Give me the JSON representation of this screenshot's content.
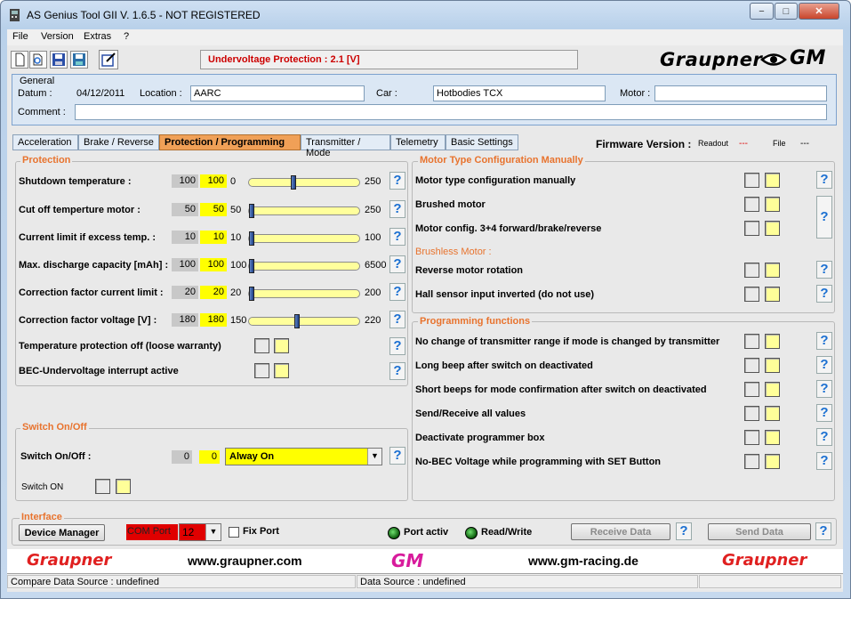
{
  "window": {
    "title": "AS Genius Tool GII V. 1.6.5 - NOT REGISTERED",
    "min": "−",
    "max": "□",
    "close": "✕"
  },
  "menu": [
    "File",
    "Version",
    "Extras",
    "?"
  ],
  "status_message": "Undervoltage Protection : 2.1 [V]",
  "logo_top": "Graupner",
  "logo_gm": "GM",
  "general": {
    "title": "General",
    "datum_label": "Datum :",
    "datum_value": "04/12/2011",
    "location_label": "Location :",
    "location_value": "AARC",
    "car_label": "Car :",
    "car_value": "Hotbodies TCX",
    "motor_label": "Motor :",
    "motor_value": "",
    "comment_label": "Comment :",
    "comment_value": ""
  },
  "tabs": [
    "Acceleration",
    "Brake / Reverse",
    "Protection / Programming",
    "Transmitter / Mode",
    "Telemetry",
    "Basic Settings"
  ],
  "firmware": {
    "label": "Firmware Version :",
    "readout_label": "Readout",
    "readout_value": "---",
    "file_label": "File",
    "file_value": "---"
  },
  "protection": {
    "title": "Protection",
    "rows": [
      {
        "label": "Shutdown temperature :",
        "gray": "100",
        "yellow": "100",
        "min": "0",
        "max": "250",
        "value": 100,
        "lo": 0,
        "hi": 250
      },
      {
        "label": "Cut off temperture motor :",
        "gray": "50",
        "yellow": "50",
        "min": "50",
        "max": "250",
        "value": 50,
        "lo": 50,
        "hi": 250
      },
      {
        "label": "Current limit if excess temp. :",
        "gray": "10",
        "yellow": "10",
        "min": "10",
        "max": "100",
        "value": 10,
        "lo": 10,
        "hi": 100
      },
      {
        "label": "Max. discharge capacity [mAh] :",
        "gray": "100",
        "yellow": "100",
        "min": "100",
        "max": "6500",
        "value": 100,
        "lo": 100,
        "hi": 6500
      },
      {
        "label": "Correction factor current limit :",
        "gray": "20",
        "yellow": "20",
        "min": "20",
        "max": "200",
        "value": 20,
        "lo": 20,
        "hi": 200
      },
      {
        "label": "Correction factor voltage [V] :",
        "gray": "180",
        "yellow": "180",
        "min": "150",
        "max": "220",
        "value": 180,
        "lo": 150,
        "hi": 220
      }
    ],
    "temp_off_label": "Temperature protection off (loose warranty)",
    "bec_label": "BEC-Undervoltage interrupt active"
  },
  "switch": {
    "title": "Switch On/Off",
    "label": "Switch On/Off :",
    "gray": "0",
    "yellow": "0",
    "select_value": "Alway On",
    "switch_on_label": "Switch ON"
  },
  "motor_type": {
    "title": "Motor Type Configuration Manually",
    "rows": [
      "Motor type configuration manually",
      "Brushed motor",
      "Motor config. 3+4 forward/brake/reverse"
    ],
    "brushless_title": "Brushless Motor :",
    "brushless_rows": [
      "Reverse motor rotation",
      "Hall sensor input inverted (do not use)"
    ]
  },
  "programming": {
    "title": "Programming functions",
    "rows": [
      "No change of transmitter range if mode is changed by transmitter",
      "Long beep after switch on deactivated",
      "Short beeps for mode confirmation after switch on deactivated",
      "Send/Receive all values",
      "Deactivate programmer box",
      "No-BEC Voltage while programming with SET Button"
    ]
  },
  "interface": {
    "title": "Interface",
    "device_manager": "Device Manager",
    "com_port_label": "COM Port",
    "com_port_value": "12",
    "fix_port": "Fix Port",
    "port_activ": "Port activ",
    "read_write": "Read/Write",
    "receive": "Receive Data",
    "send": "Send Data"
  },
  "footer": {
    "graupner": "Graupner",
    "url1": "www.graupner.com",
    "gm": "GM",
    "url2": "www.gm-racing.de"
  },
  "statusbar": {
    "compare": "Compare Data Source : undefined",
    "source": "Data Source : undefined"
  },
  "help_glyph": "?"
}
